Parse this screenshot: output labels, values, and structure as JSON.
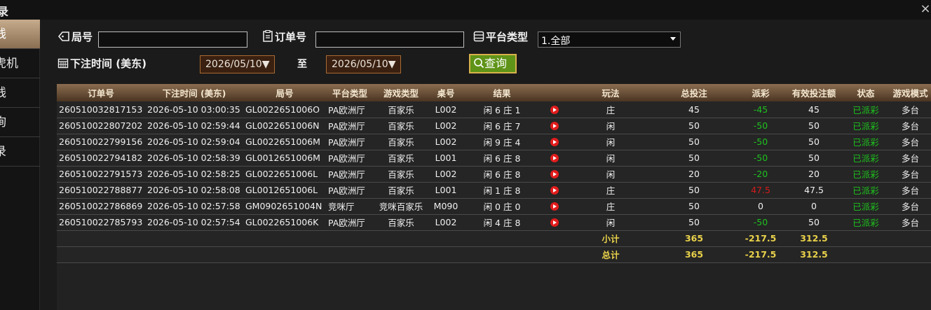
{
  "window": {
    "title": "录",
    "close_glyph": "×"
  },
  "sidebar": {
    "items": [
      {
        "label": "钱",
        "active": true
      },
      {
        "label": "虎机",
        "active": false
      },
      {
        "label": "钱",
        "active": false
      },
      {
        "label": "询",
        "active": false
      },
      {
        "label": "录",
        "active": false
      }
    ]
  },
  "filters": {
    "round_label": "局号",
    "round_value": "",
    "order_label": "订单号",
    "order_value": "",
    "platform_label": "平台类型",
    "platform_value": "1.全部",
    "time_label": "下注时间 (美东)",
    "date_from": "2026/05/10▼",
    "to_label": "至",
    "date_to": "2026/05/10▼",
    "query_label": "查询"
  },
  "table": {
    "headers": [
      "订单号",
      "下注时间 (美东)",
      "局号",
      "平台类型",
      "游戏类型",
      "桌号",
      "结果",
      "",
      "玩法",
      "总投注",
      "派彩",
      "有效投注额",
      "状态",
      "游戏模式"
    ],
    "rows": [
      [
        "260510032817153",
        "2026-05-10 03:00:35",
        "GL0022651006O",
        "PA欧洲厅",
        "百家乐",
        "L002",
        "闲 6 庄 1",
        "",
        "庄",
        "45",
        "-45",
        "45",
        "已派彩",
        "多台"
      ],
      [
        "260510022807202",
        "2026-05-10 02:59:44",
        "GL0022651006N",
        "PA欧洲厅",
        "百家乐",
        "L002",
        "闲 6 庄 7",
        "",
        "闲",
        "50",
        "-50",
        "50",
        "已派彩",
        "多台"
      ],
      [
        "260510022799156",
        "2026-05-10 02:59:04",
        "GL0022651006M",
        "PA欧洲厅",
        "百家乐",
        "L002",
        "闲 9 庄 4",
        "",
        "闲",
        "50",
        "-50",
        "50",
        "已派彩",
        "多台"
      ],
      [
        "260510022794182",
        "2026-05-10 02:58:39",
        "GL0012651006M",
        "PA欧洲厅",
        "百家乐",
        "L001",
        "闲 6 庄 8",
        "",
        "闲",
        "50",
        "-50",
        "50",
        "已派彩",
        "多台"
      ],
      [
        "260510022791573",
        "2026-05-10 02:58:25",
        "GL0022651006L",
        "PA欧洲厅",
        "百家乐",
        "L002",
        "闲 6 庄 8",
        "",
        "闲",
        "20",
        "-20",
        "20",
        "已派彩",
        "多台"
      ],
      [
        "260510022788877",
        "2026-05-10 02:58:08",
        "GL0012651006L",
        "PA欧洲厅",
        "百家乐",
        "L001",
        "闲 1 庄 8",
        "",
        "庄",
        "50",
        "47.5",
        "47.5",
        "已派彩",
        "多台"
      ],
      [
        "260510022786869",
        "2026-05-10 02:57:58",
        "GM0902651004N",
        "竞咪厅",
        "竞咪百家乐",
        "M090",
        "闲 0 庄 0",
        "",
        "庄",
        "50",
        "0",
        "0",
        "已派彩",
        "多台"
      ],
      [
        "260510022785793",
        "2026-05-10 02:57:54",
        "GL0022651006K",
        "PA欧洲厅",
        "百家乐",
        "L002",
        "闲 4 庄 8",
        "",
        "闲",
        "50",
        "-50",
        "50",
        "已派彩",
        "多台"
      ]
    ],
    "subtotal": {
      "label": "小计",
      "total_bet": "365",
      "payout": "-217.5",
      "valid_bet": "312.5"
    },
    "total": {
      "label": "总计",
      "total_bet": "365",
      "payout": "-217.5",
      "valid_bet": "312.5"
    }
  }
}
